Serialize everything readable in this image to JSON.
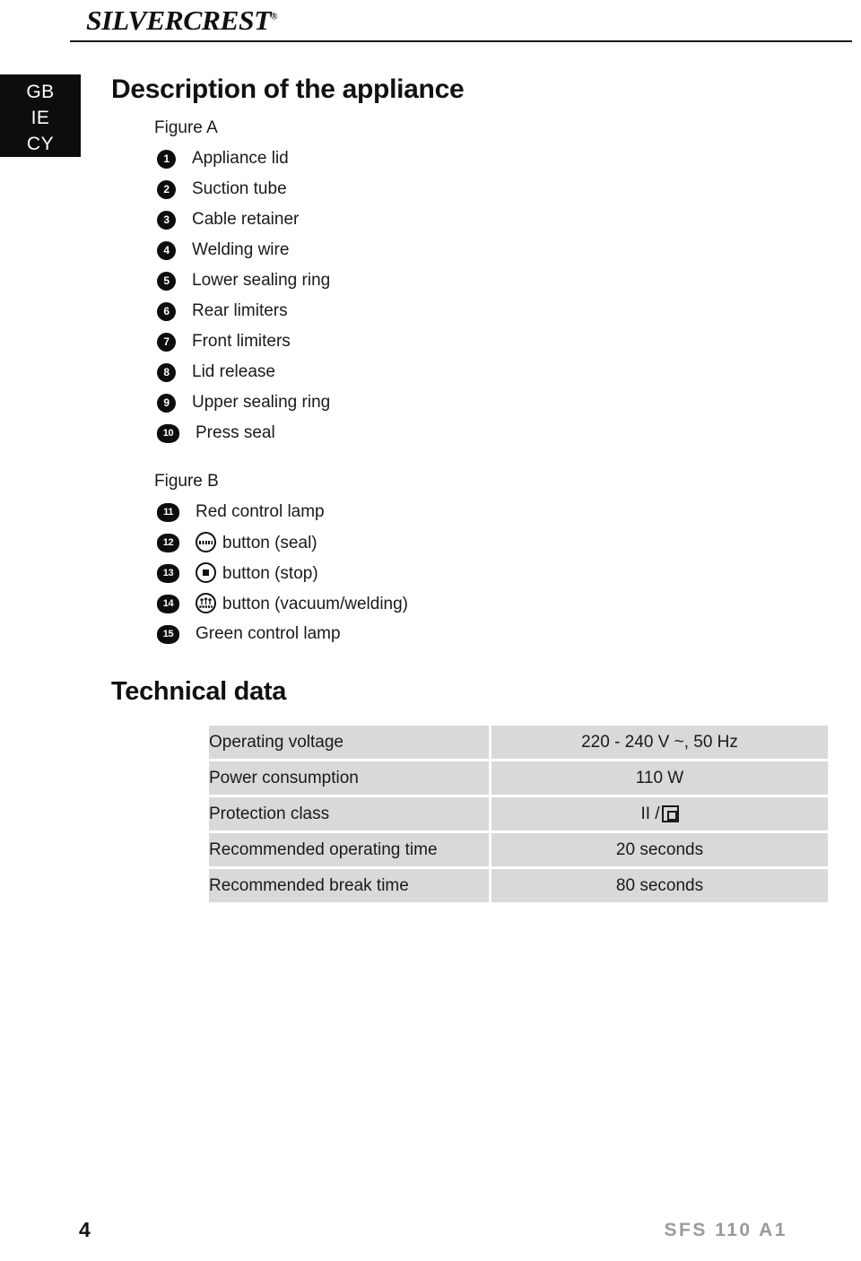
{
  "header": {
    "brand_silver": "SILVER",
    "brand_crest": "CREST",
    "registered_mark": "®",
    "language_tabs": [
      "GB",
      "IE",
      "CY"
    ]
  },
  "main": {
    "section_title": "Description of the appliance",
    "figure_a_label": "Figure A",
    "figure_a_items": [
      {
        "number": "1",
        "label": "Appliance lid"
      },
      {
        "number": "2",
        "label": "Suction tube"
      },
      {
        "number": "3",
        "label": "Cable retainer"
      },
      {
        "number": "4",
        "label": "Welding wire"
      },
      {
        "number": "5",
        "label": "Lower sealing ring"
      },
      {
        "number": "6",
        "label": "Rear limiters"
      },
      {
        "number": "7",
        "label": "Front limiters"
      },
      {
        "number": "8",
        "label": "Lid release"
      },
      {
        "number": "9",
        "label": "Upper sealing ring"
      },
      {
        "number": "10",
        "label": "Press seal"
      }
    ],
    "figure_b_label": "Figure B",
    "figure_b_items": [
      {
        "number": "11",
        "icon": "",
        "label": "Red control lamp"
      },
      {
        "number": "12",
        "icon": "seal-button-icon",
        "label": "button (seal)"
      },
      {
        "number": "13",
        "icon": "stop-button-icon",
        "label": "button (stop)"
      },
      {
        "number": "14",
        "icon": "vacuum-welding-button-icon",
        "label": "button (vacuum/welding)"
      },
      {
        "number": "15",
        "icon": "",
        "label": "Green control lamp"
      }
    ]
  },
  "technical_data": {
    "heading": "Technical data",
    "rows": [
      {
        "key": "Operating voltage",
        "value": "220 - 240 V ~, 50 Hz"
      },
      {
        "key": "Power consumption",
        "value": "110 W"
      },
      {
        "key": "Protection class",
        "value": "II /",
        "symbol": "class-2-double-insulation"
      },
      {
        "key": "Recommended operating time",
        "value": "20 seconds"
      },
      {
        "key": "Recommended break time",
        "value": "80 seconds"
      }
    ]
  },
  "footer": {
    "page_number": "4",
    "model_code": "SFS 110 A1"
  },
  "colors": {
    "text": "#1a1a1a",
    "table_cell": "#d9d9d9",
    "tab_background": "#0d0d0d",
    "footer_model": "#9a9a9a"
  }
}
